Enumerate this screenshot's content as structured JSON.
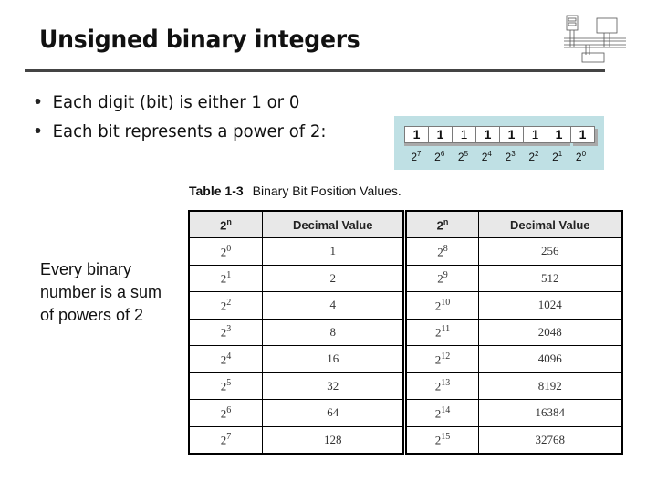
{
  "slide": {
    "title": "Unsigned binary integers",
    "logo_icon": "computer-architecture-diagram-icon"
  },
  "bullets": [
    {
      "text": "Each digit (bit) is either 1 or 0"
    },
    {
      "text": "Each bit represents a power of 2:"
    }
  ],
  "bit_diagram": {
    "bits": [
      "1",
      "1",
      "1",
      "1",
      "1",
      "1",
      "1",
      "1"
    ],
    "powers": [
      {
        "base": "2",
        "exp": "7"
      },
      {
        "base": "2",
        "exp": "6"
      },
      {
        "base": "2",
        "exp": "5"
      },
      {
        "base": "2",
        "exp": "4"
      },
      {
        "base": "2",
        "exp": "3"
      },
      {
        "base": "2",
        "exp": "2"
      },
      {
        "base": "2",
        "exp": "1"
      },
      {
        "base": "2",
        "exp": "0"
      }
    ]
  },
  "table": {
    "caption_number": "Table 1-3",
    "caption_title": "Binary Bit Position Values.",
    "headers": [
      {
        "base": "2",
        "exp": "n"
      },
      {
        "text": "Decimal Value"
      },
      {
        "base": "2",
        "exp": "n"
      },
      {
        "text": "Decimal Value"
      }
    ],
    "rows": [
      {
        "exp_left": "0",
        "value_left": "1",
        "exp_right": "8",
        "value_right": "256"
      },
      {
        "exp_left": "1",
        "value_left": "2",
        "exp_right": "9",
        "value_right": "512"
      },
      {
        "exp_left": "2",
        "value_left": "4",
        "exp_right": "10",
        "value_right": "1024"
      },
      {
        "exp_left": "3",
        "value_left": "8",
        "exp_right": "11",
        "value_right": "2048"
      },
      {
        "exp_left": "4",
        "value_left": "16",
        "exp_right": "12",
        "value_right": "4096"
      },
      {
        "exp_left": "5",
        "value_left": "32",
        "exp_right": "13",
        "value_right": "8192"
      },
      {
        "exp_left": "6",
        "value_left": "64",
        "exp_right": "14",
        "value_right": "16384"
      },
      {
        "exp_left": "7",
        "value_left": "128",
        "exp_right": "15",
        "value_right": "32768"
      }
    ],
    "base": "2"
  },
  "side_note": {
    "text": "Every binary number is a sum of powers of 2"
  },
  "colors": {
    "title_rule": "#444444",
    "bit_panel_bg": "#bfe0e4",
    "table_header_bg": "#e8e8e8"
  }
}
